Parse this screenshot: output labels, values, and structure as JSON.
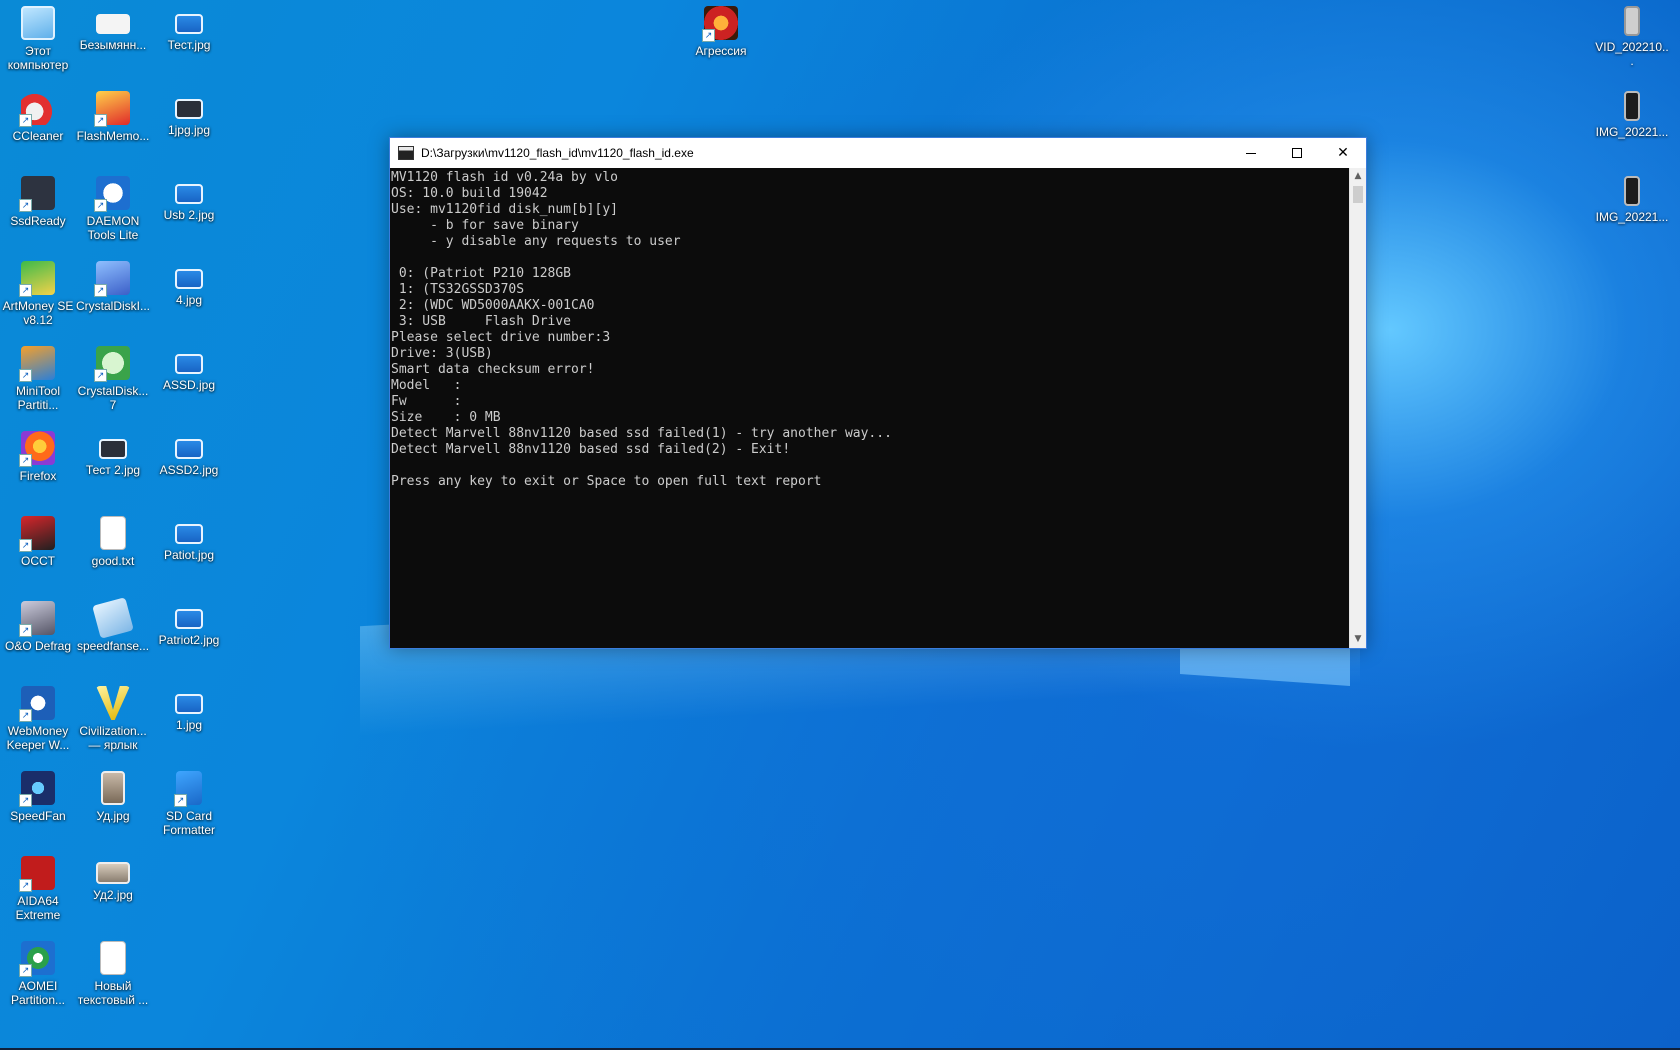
{
  "desktop": {
    "icons_col1": [
      {
        "label": "Этот компьютер",
        "icon": "computer-icon"
      },
      {
        "label": "CCleaner",
        "icon": "ccleaner-icon"
      },
      {
        "label": "SsdReady",
        "icon": "ssdready-icon"
      },
      {
        "label": "ArtMoney SE v8.12",
        "icon": "artmoney-icon"
      },
      {
        "label": "MiniTool Partiti...",
        "icon": "minitool-icon"
      },
      {
        "label": "Firefox",
        "icon": "firefox-icon"
      },
      {
        "label": "OCCT",
        "icon": "occt-icon"
      },
      {
        "label": "O&O Defrag",
        "icon": "oodefrag-icon"
      },
      {
        "label": "WebMoney Keeper W...",
        "icon": "webmoney-icon"
      },
      {
        "label": "SpeedFan",
        "icon": "speedfan-icon"
      },
      {
        "label": "AIDA64 Extreme",
        "icon": "aida64-icon"
      },
      {
        "label": "AOMEI Partition...",
        "icon": "aomei-icon"
      }
    ],
    "icons_col2": [
      {
        "label": "Безымянн...",
        "icon": "paint-image-icon"
      },
      {
        "label": "FlashMemo...",
        "icon": "flashmemory-icon"
      },
      {
        "label": "DAEMON Tools Lite",
        "icon": "daemon-tools-icon"
      },
      {
        "label": "CrystalDiskI...",
        "icon": "crystaldiskinfo-icon"
      },
      {
        "label": "CrystalDisk... 7",
        "icon": "crystaldiskmark-icon"
      },
      {
        "label": "Тест 2.jpg",
        "icon": "image-file-icon"
      },
      {
        "label": "good.txt",
        "icon": "text-file-icon"
      },
      {
        "label": "speedfanse...",
        "icon": "speedfan-setup-icon"
      },
      {
        "label": "Civilization... — ярлык",
        "icon": "civilization-icon"
      },
      {
        "label": "Уд.jpg",
        "icon": "image-file-icon"
      },
      {
        "label": "Уд2.jpg",
        "icon": "image-file-icon"
      },
      {
        "label": "Новый текстовый ...",
        "icon": "text-file-icon"
      }
    ],
    "icons_col3": [
      {
        "label": "Тест.jpg",
        "icon": "image-file-icon"
      },
      {
        "label": "1jpg.jpg",
        "icon": "image-file-icon"
      },
      {
        "label": "Usb 2.jpg",
        "icon": "image-file-icon"
      },
      {
        "label": "4.jpg",
        "icon": "image-file-icon"
      },
      {
        "label": "ASSD.jpg",
        "icon": "image-file-icon"
      },
      {
        "label": "ASSD2.jpg",
        "icon": "image-file-icon"
      },
      {
        "label": "Patiot.jpg",
        "icon": "image-file-icon"
      },
      {
        "label": "Patriot2.jpg",
        "icon": "image-file-icon"
      },
      {
        "label": "1.jpg",
        "icon": "image-file-icon"
      },
      {
        "label": "SD Card Formatter",
        "icon": "sd-card-icon"
      }
    ],
    "icon_top": {
      "label": "Агрессия",
      "icon": "game-icon"
    },
    "icons_right": [
      {
        "label": "VID_202210...",
        "icon": "video-file-icon"
      },
      {
        "label": "IMG_20221...",
        "icon": "image-file-icon"
      },
      {
        "label": "IMG_20221...",
        "icon": "image-file-icon"
      }
    ]
  },
  "window": {
    "title": "D:\\Загрузки\\mv1120_flash_id\\mv1120_flash_id.exe",
    "minimize": "minimize",
    "maximize": "maximize",
    "close": "✕",
    "console_lines": [
      "MV1120 flash id v0.24a by vlo",
      "OS: 10.0 build 19042",
      "Use: mv1120fid disk_num[b][y]",
      "     - b for save binary",
      "     - y disable any requests to user",
      "",
      " 0: (Patriot P210 128GB",
      " 1: (TS32GSSD370S",
      " 2: (WDC WD5000AAKX-001CA0",
      " 3: USB     Flash Drive",
      "Please select drive number:3",
      "Drive: 3(USB)",
      "Smart data checksum error!",
      "Model   :",
      "Fw      :",
      "Size    : 0 MB",
      "Detect Marvell 88nv1120 based ssd failed(1) - try another way...",
      "Detect Marvell 88nv1120 based ssd failed(2) - Exit!",
      "",
      "Press any key to exit or Space to open full text report"
    ],
    "scroll_up": "▲",
    "scroll_down": "▼"
  },
  "colors": {
    "console_bg": "#0c0c0c",
    "console_text": "#cccccc",
    "desktop_blue": "#0a86dc"
  }
}
